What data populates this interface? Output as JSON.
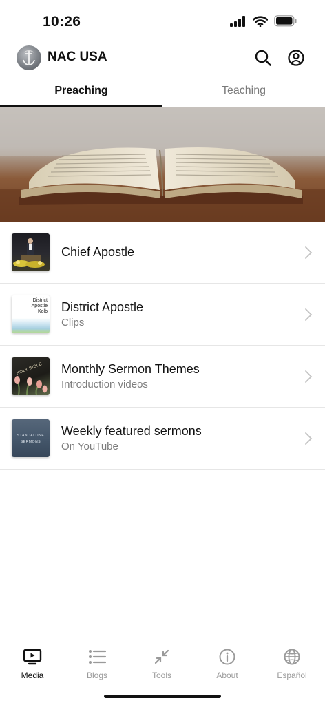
{
  "status_bar": {
    "time": "10:26"
  },
  "header": {
    "title": "NAC USA"
  },
  "tabs": [
    {
      "label": "Preaching",
      "active": true
    },
    {
      "label": "Teaching",
      "active": false
    }
  ],
  "list": [
    {
      "title": "Chief Apostle",
      "subtitle": ""
    },
    {
      "title": "District Apostle",
      "subtitle": "Clips",
      "thumb_text": [
        "District",
        "Apostle",
        "Kolb"
      ]
    },
    {
      "title": "Monthly Sermon Themes",
      "subtitle": "Introduction videos",
      "thumb_text": "HOLY BIBLE"
    },
    {
      "title": "Weekly featured sermons",
      "subtitle": "On YouTube",
      "thumb_text": [
        "STANDALONE",
        "SERMONS"
      ]
    }
  ],
  "bottom_nav": [
    {
      "label": "Media",
      "icon": "tv-icon",
      "active": true
    },
    {
      "label": "Blogs",
      "icon": "list-icon",
      "active": false
    },
    {
      "label": "Tools",
      "icon": "collapse-arrows-icon",
      "active": false
    },
    {
      "label": "About",
      "icon": "info-icon",
      "active": false
    },
    {
      "label": "Español",
      "icon": "globe-icon",
      "active": false
    }
  ],
  "colors": {
    "active": "#111111",
    "inactive": "#9a9a9a",
    "divider": "#e6e6e6"
  }
}
